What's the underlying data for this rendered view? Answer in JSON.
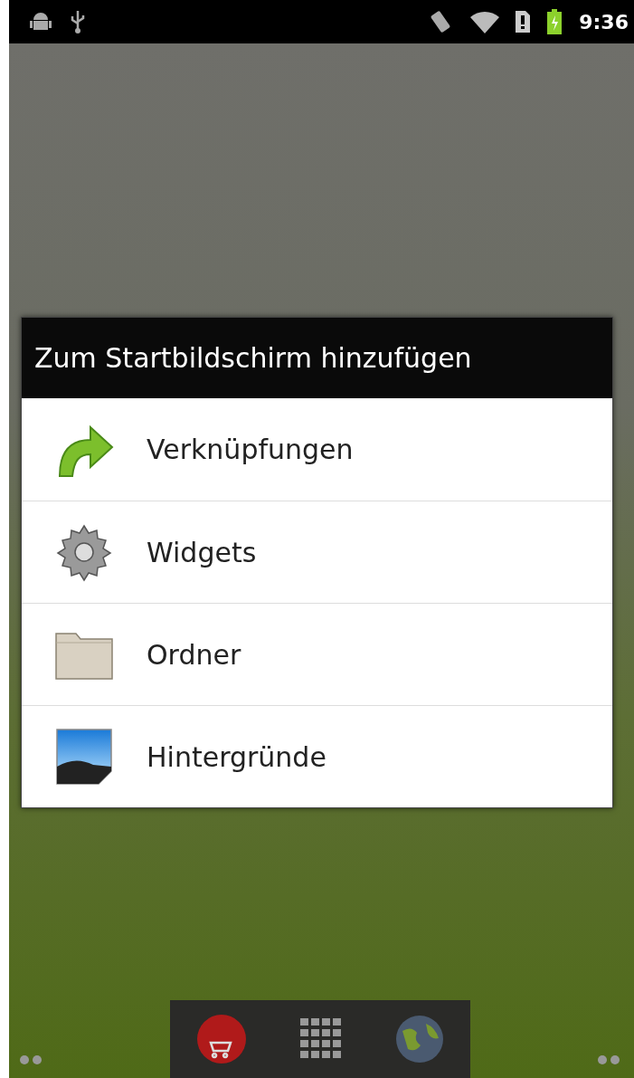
{
  "status_bar": {
    "time": "9:36"
  },
  "dialog": {
    "title": "Zum Startbildschirm hinzufügen",
    "items": [
      {
        "label": "Verknüpfungen",
        "kind": "shortcut"
      },
      {
        "label": "Widgets",
        "kind": "widget"
      },
      {
        "label": "Ordner",
        "kind": "folder"
      },
      {
        "label": "Hintergründe",
        "kind": "wallpaper"
      }
    ]
  }
}
